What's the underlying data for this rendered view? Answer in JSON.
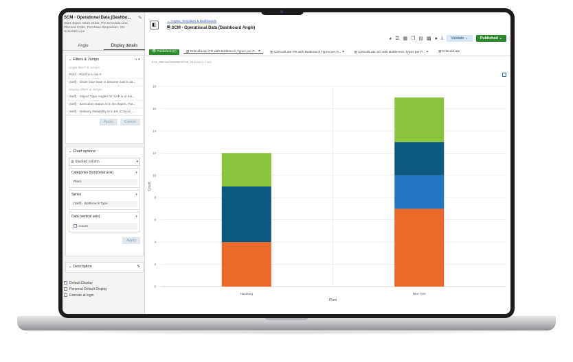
{
  "sidebar": {
    "title": "SCM - Operational Data (Dashbo...",
    "description": "Start object: Work Order, PO Schedule Line, Planned Order, Purchase Requisition, SO Schedule Line",
    "tabs": [
      {
        "label": "Angle"
      },
      {
        "label": "Display details"
      }
    ],
    "filters": {
      "header": "Filters & Jumps",
      "angle_section": "Angle filters & Jumps",
      "angle_items": [
        "Plant - Plant is in list P",
        "(Self) - Order Due Date is between last 5 da...",
        "(Self) - Object Type Angles for SAP is in list..."
      ],
      "display_section": "Display filters & Jumps",
      "display_items": [
        "(Self) - Object Type Angles for SAP is in list...",
        "(Self) - Execution Status is in list (Open, Par...",
        "(Self) - Delivery Reliability is in list (Critical, ..."
      ],
      "apply": "Apply",
      "cancel": "Cancel"
    },
    "chart_options": {
      "header": "Chart options",
      "chart_type": "Stacked column",
      "categories_header": "Categories (horizontal axis)",
      "categories_value": "Plant",
      "series_header": "Series",
      "series_value": "(Self) - Bottleneck Type",
      "data_header": "Data (vertical axis)",
      "data_value": "Count",
      "apply": "Apply"
    },
    "description_header": "Description",
    "footer": [
      "Default Display",
      "Personal Default Display",
      "Execute at login"
    ]
  },
  "main": {
    "breadcrumb": "Angles, Templates & Dashboards",
    "title": "SCM - Operational Data (Dashboard Angle)",
    "validate": "Validate",
    "published": "Published",
    "tabs": [
      {
        "label": "Published (0)"
      },
      {
        "label": "Critical/Late PO with Bottleneck Types per P..."
      },
      {
        "label": "Critical/Late PR with Bottleneck Types per P..."
      },
      {
        "label": "Critical/Late SO with Bottleneck Types per P..."
      },
      {
        "label": "Critical/Late"
      }
    ],
    "info": "EA6_000 Jan/26/2023 07:28, 28 items in 1 sec"
  },
  "colors": {
    "orange": "#e8692a",
    "lightblue": "#2277c0",
    "darkteal": "#0b5a7d",
    "green": "#8cc43d"
  },
  "chart_data": {
    "type": "bar",
    "stacked": true,
    "categories": [
      "Hamburg",
      "New York"
    ],
    "series": [
      {
        "values": [
          4,
          7
        ],
        "color": "#e8692a"
      },
      {
        "values": [
          0,
          3
        ],
        "color": "#2277c0"
      },
      {
        "values": [
          5,
          3
        ],
        "color": "#0b5a7d"
      },
      {
        "values": [
          3,
          4
        ],
        "color": "#8cc43d"
      }
    ],
    "xlabel": "Plant",
    "ylabel": "Count",
    "ylim": [
      0,
      18
    ],
    "yticks": [
      0,
      2,
      4,
      6,
      8,
      10,
      12,
      14,
      16,
      18
    ],
    "grid": true
  }
}
